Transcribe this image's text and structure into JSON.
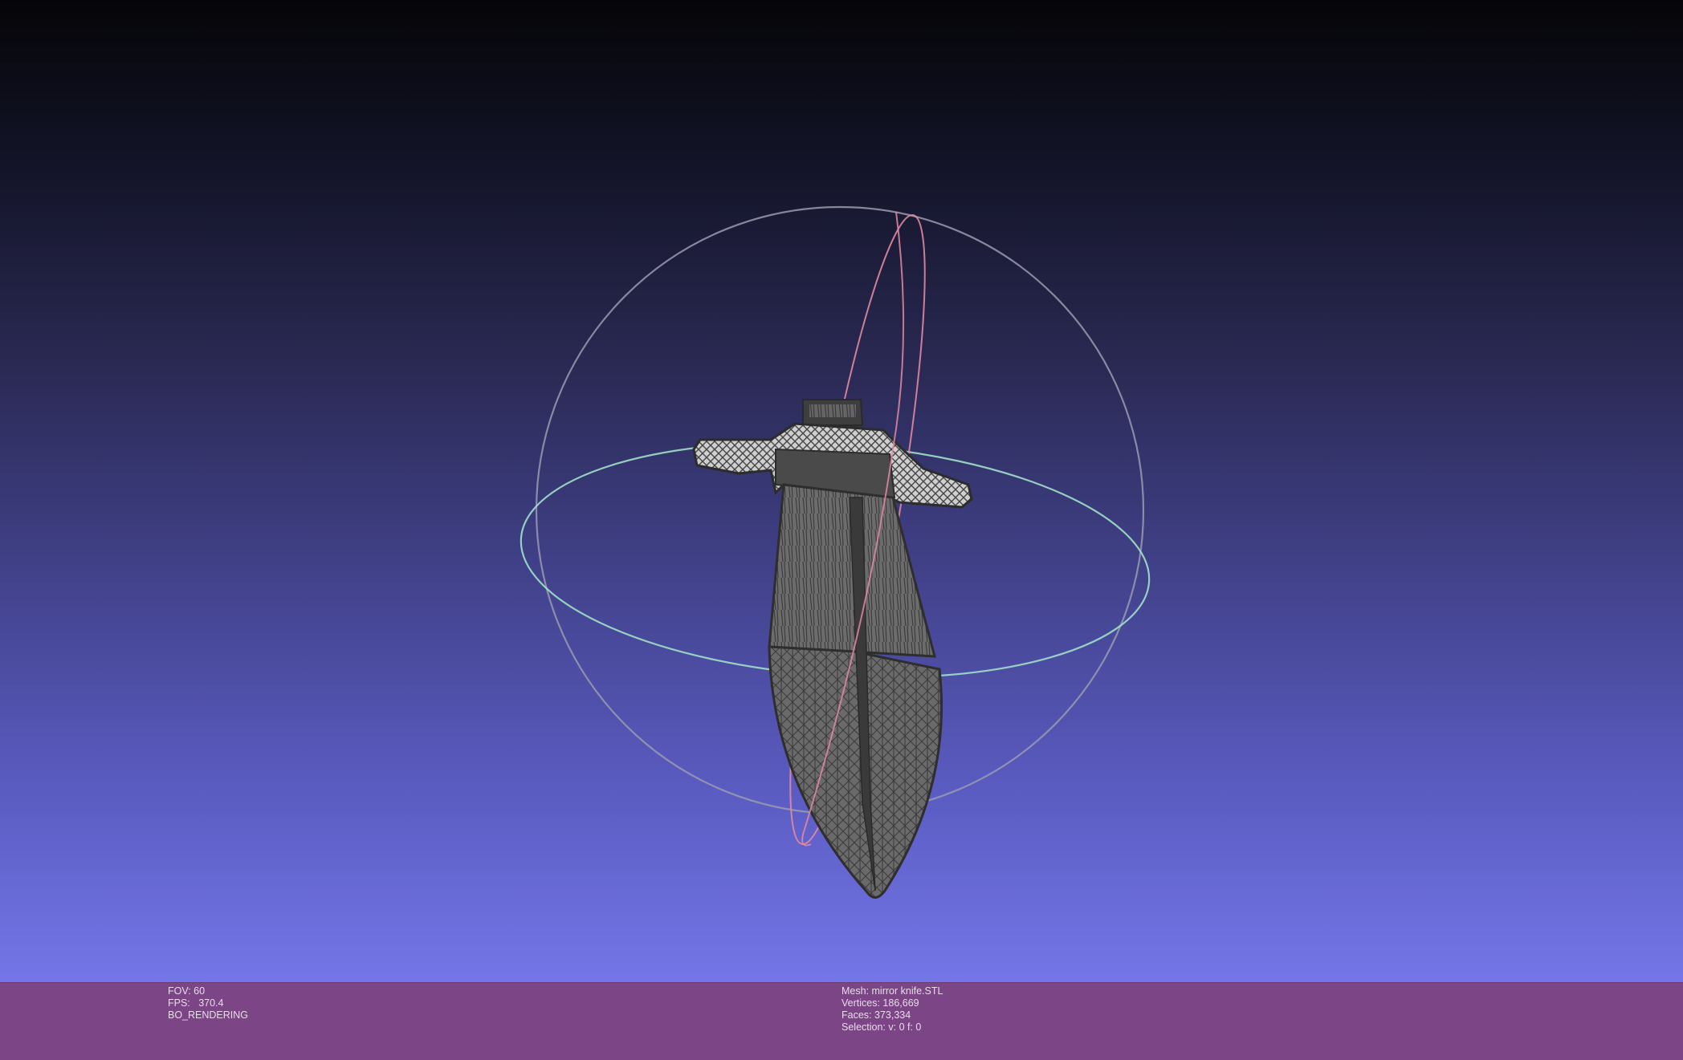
{
  "viewport": {
    "colors": {
      "top": "#050508",
      "bottom": "#7476e8",
      "status_bar": "#7c4585",
      "mesh": "#4a4a4a",
      "trackball_red": "#e08aa0",
      "trackball_green": "#9fe0c8",
      "trackball_blue": "#9a9ab0"
    },
    "trackball": {
      "icon": "trackball-icon"
    },
    "mesh_render": "wireframe"
  },
  "status_left": {
    "fov": "FOV: 60",
    "fps": "FPS:   370.4",
    "mode": "BO_RENDERING"
  },
  "status_right": {
    "mesh": "Mesh: mirror knife.STL",
    "vertices": "Vertices: 186,669",
    "faces": "Faces: 373,334",
    "selection": "Selection: v: 0 f: 0"
  }
}
